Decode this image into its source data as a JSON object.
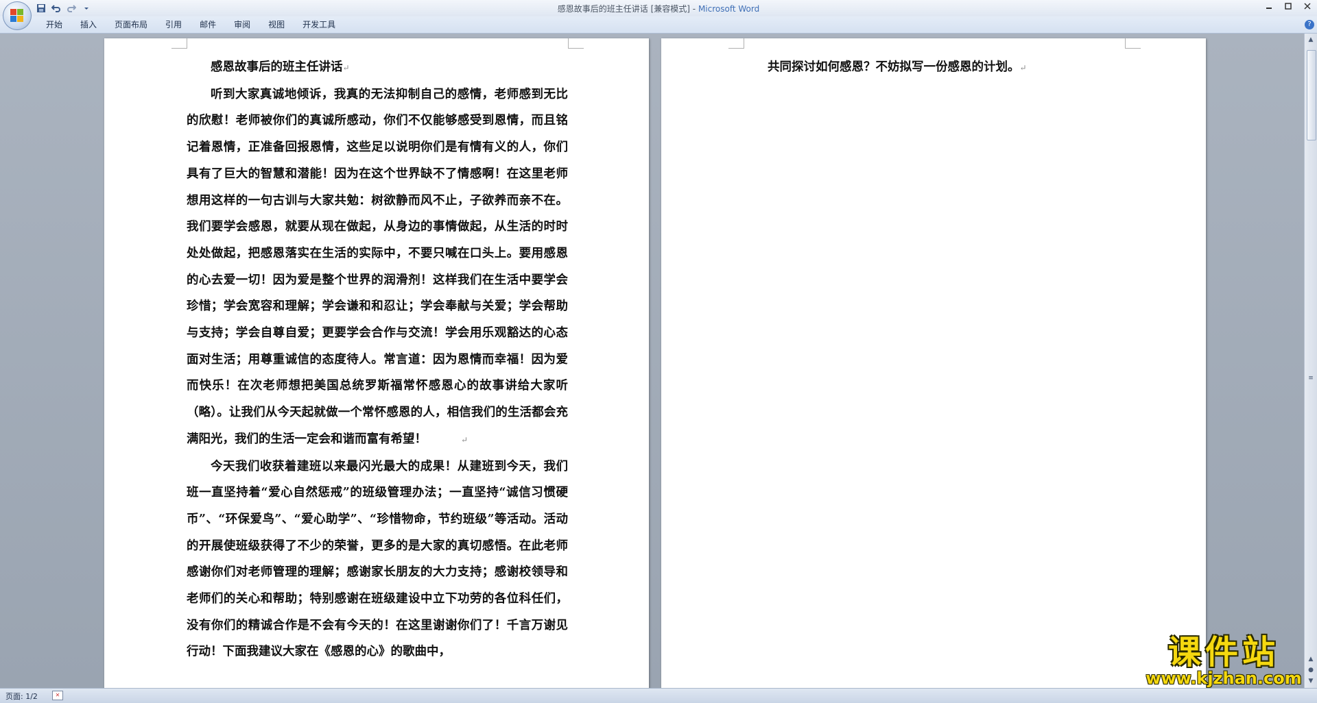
{
  "window": {
    "doc_name": "感恩故事后的班主任讲话 [兼容模式]",
    "separator": " - ",
    "app_name": "Microsoft Word"
  },
  "quick_access": [
    "save-icon",
    "undo-icon",
    "redo-icon",
    "customize-dropdown-icon"
  ],
  "tabs": [
    "开始",
    "插入",
    "页面布局",
    "引用",
    "邮件",
    "审阅",
    "视图",
    "开发工具"
  ],
  "document": {
    "title": "感恩故事后的班主任讲话",
    "paragraph1": "听到大家真诚地倾诉，我真的无法抑制自己的感情，老师感到无比的欣慰！老师被你们的真诚所感动，你们不仅能够感受到恩情，而且铭记着恩情，正准备回报恩情，这些足以说明你们是有情有义的人，你们具有了巨大的智慧和潜能！因为在这个世界缺不了情感啊！在这里老师想用这样的一句古训与大家共勉：树欲静而风不止，子欲养而亲不在。我们要学会感恩，就要从现在做起，从身边的事情做起，从生活的时时处处做起，把感恩落实在生活的实际中，不要只喊在口头上。要用感恩的心去爱一切！因为爱是整个世界的润滑剂！这样我们在生活中要学会珍惜；学会宽容和理解；学会谦和和忍让；学会奉献与关爱；学会帮助与支持；学会自尊自爱；更要学会合作与交流！学会用乐观豁达的心态面对生活；用尊重诚信的态度待人。常言道：因为恩情而幸福！因为爱而快乐！在次老师想把美国总统罗斯福常怀感恩心的故事讲给大家听（略）。让我们从今天起就做一个常怀感恩的人，相信我们的生活都会充满阳光，我们的生活一定会和谐而富有希望！",
    "paragraph2": "今天我们收获着建班以来最闪光最大的成果！从建班到今天，我们班一直坚持着“爱心自然惩戒”的班级管理办法；一直坚持“诚信习惯硬币”、“环保爱鸟”、“爱心助学”、“珍惜物命，节约班级”等活动。活动的开展使班级获得了不少的荣誉，更多的是大家的真切感悟。在此老师感谢你们对老师管理的理解；感谢家长朋友的大力支持；感谢校领导和老师们的关心和帮助；特别感谢在班级建设中立下功劳的各位科任们，没有你们的精诚合作是不会有今天的！在这里谢谢你们了！千言万谢见行动！下面我建议大家在《感恩的心》的歌曲中，",
    "page2_text": "共同探讨如何感恩？不妨拟写一份感恩的计划。",
    "paragraph_mark": "↵"
  },
  "statusbar": {
    "page_count": "页面: 1/2"
  },
  "watermark": {
    "title": "课件站",
    "url": "www.kjzhan.com"
  },
  "colors": {
    "app_title": "#3f6fb6",
    "watermark": "#f5d80f"
  }
}
